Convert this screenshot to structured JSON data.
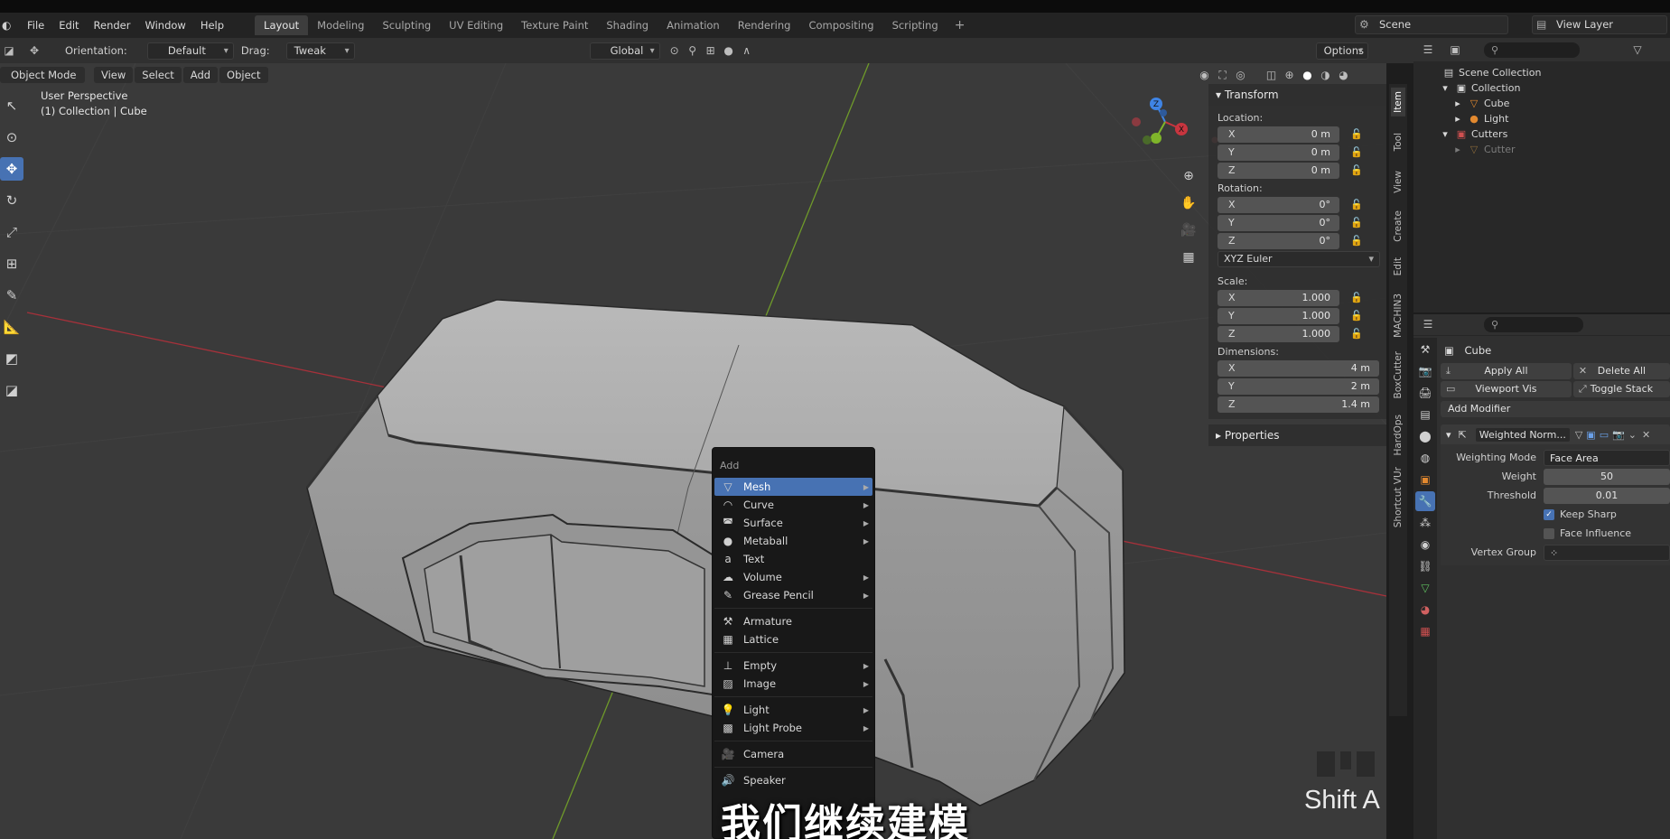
{
  "menubar": {
    "items": [
      "File",
      "Edit",
      "Render",
      "Window",
      "Help"
    ],
    "workspaces": [
      "Layout",
      "Modeling",
      "Sculpting",
      "UV Editing",
      "Texture Paint",
      "Shading",
      "Animation",
      "Rendering",
      "Compositing",
      "Scripting"
    ],
    "active_workspace": "Layout",
    "scene": "Scene",
    "view_layer": "View Layer"
  },
  "toolbar": {
    "orientation_label": "Orientation:",
    "orientation_value": "Default",
    "drag_label": "Drag:",
    "drag_value": "Tweak",
    "transform_orientation": "Global",
    "options": "Options"
  },
  "viewport_header": {
    "mode": "Object Mode",
    "view": "View",
    "select": "Select",
    "add": "Add",
    "object": "Object"
  },
  "viewport": {
    "perspective": "User Perspective",
    "collection_info": "(1) Collection | Cube",
    "gizmo_axes": [
      "X",
      "Y",
      "Z"
    ]
  },
  "add_menu": {
    "title": "Add",
    "groups": [
      [
        {
          "label": "Mesh",
          "icon": "mesh-icon",
          "submenu": true,
          "highlighted": true
        },
        {
          "label": "Curve",
          "icon": "curve-icon",
          "submenu": true
        },
        {
          "label": "Surface",
          "icon": "surface-icon",
          "submenu": true
        },
        {
          "label": "Metaball",
          "icon": "metaball-icon",
          "submenu": true
        },
        {
          "label": "Text",
          "icon": "text-icon",
          "submenu": false
        },
        {
          "label": "Volume",
          "icon": "volume-icon",
          "submenu": true
        },
        {
          "label": "Grease Pencil",
          "icon": "grease-pencil-icon",
          "submenu": true
        }
      ],
      [
        {
          "label": "Armature",
          "icon": "armature-icon",
          "submenu": false
        },
        {
          "label": "Lattice",
          "icon": "lattice-icon",
          "submenu": false
        }
      ],
      [
        {
          "label": "Empty",
          "icon": "empty-icon",
          "submenu": true
        },
        {
          "label": "Image",
          "icon": "image-icon",
          "submenu": true
        }
      ],
      [
        {
          "label": "Light",
          "icon": "light-icon",
          "submenu": true
        },
        {
          "label": "Light Probe",
          "icon": "light-probe-icon",
          "submenu": true
        }
      ],
      [
        {
          "label": "Camera",
          "icon": "camera-icon",
          "submenu": false
        }
      ],
      [
        {
          "label": "Speaker",
          "icon": "speaker-icon",
          "submenu": false
        }
      ]
    ]
  },
  "npanel": {
    "transform_title": "Transform",
    "location_label": "Location:",
    "location": [
      {
        "axis": "X",
        "value": "0 m"
      },
      {
        "axis": "Y",
        "value": "0 m"
      },
      {
        "axis": "Z",
        "value": "0 m"
      }
    ],
    "rotation_label": "Rotation:",
    "rotation": [
      {
        "axis": "X",
        "value": "0°"
      },
      {
        "axis": "Y",
        "value": "0°"
      },
      {
        "axis": "Z",
        "value": "0°"
      }
    ],
    "rotation_mode": "XYZ Euler",
    "scale_label": "Scale:",
    "scale": [
      {
        "axis": "X",
        "value": "1.000"
      },
      {
        "axis": "Y",
        "value": "1.000"
      },
      {
        "axis": "Z",
        "value": "1.000"
      }
    ],
    "dimensions_label": "Dimensions:",
    "dimensions": [
      {
        "axis": "X",
        "value": "4 m"
      },
      {
        "axis": "Y",
        "value": "2 m"
      },
      {
        "axis": "Z",
        "value": "1.4 m"
      }
    ],
    "properties_title": "Properties",
    "tabs": [
      "Item",
      "Tool",
      "View",
      "Create",
      "Edit",
      "MACHIN3",
      "BoxCutter",
      "HardOps",
      "Shortcut VUr"
    ]
  },
  "outliner": {
    "rows": [
      {
        "label": "Scene Collection",
        "indent": 0,
        "icon": "scene-collection-icon",
        "dim": false
      },
      {
        "label": "Collection",
        "indent": 1,
        "icon": "collection-icon",
        "dim": false
      },
      {
        "label": "Cube",
        "indent": 2,
        "icon": "mesh-object-icon",
        "dim": false
      },
      {
        "label": "Light",
        "indent": 2,
        "icon": "light-object-icon",
        "dim": false
      },
      {
        "label": "Cutters",
        "indent": 1,
        "icon": "collection-icon",
        "dim": false
      },
      {
        "label": "Cutter",
        "indent": 2,
        "icon": "mesh-object-icon",
        "dim": true
      }
    ]
  },
  "properties": {
    "object_name": "Cube",
    "apply_all": "Apply All",
    "delete_all": "Delete All",
    "viewport_vis": "Viewport Vis",
    "toggle_stack": "Toggle Stack",
    "add_modifier": "Add Modifier",
    "modifier_name": "Weighted Norm...",
    "weighting_mode_label": "Weighting Mode",
    "weighting_mode": "Face Area",
    "weight_label": "Weight",
    "weight": "50",
    "threshold_label": "Threshold",
    "threshold": "0.01",
    "keep_sharp": "Keep Sharp",
    "face_influence": "Face Influence",
    "vertex_group_label": "Vertex Group"
  },
  "overlay": {
    "subtitle": "我们继续建模",
    "shortcut": "Shift A"
  },
  "colors": {
    "accent": "#4772b3",
    "x_axis": "#c8353f",
    "y_axis": "#7fb52a",
    "z_axis": "#3f84e5"
  }
}
